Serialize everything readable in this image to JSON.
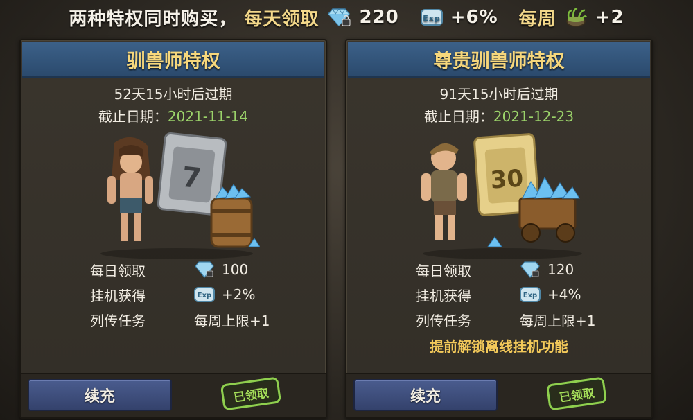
{
  "banner": {
    "intro": "两种特权同时购买，",
    "daily_label": "每天领取",
    "daily_gem_value": "220",
    "exp_value": "+6%",
    "weekly_label": "每周",
    "weekly_value": "+2"
  },
  "panels": [
    {
      "title": "驯兽师特权",
      "expire_text": "52天15小时后过期",
      "deadline_label": "截止日期：",
      "deadline_date": "2021-11-14",
      "card_number": "7",
      "benefits": [
        {
          "label": "每日领取",
          "icon": "gem-icon",
          "value": "100"
        },
        {
          "label": "挂机获得",
          "icon": "exp-icon",
          "value": "+2%"
        },
        {
          "label": "列传任务",
          "icon": "",
          "value": "每周上限+1"
        }
      ],
      "unlock_note": "",
      "renew_label": "续充",
      "claimed_label": "已领取"
    },
    {
      "title": "尊贵驯兽师特权",
      "expire_text": "91天15小时后过期",
      "deadline_label": "截止日期：",
      "deadline_date": "2021-12-23",
      "card_number": "30",
      "benefits": [
        {
          "label": "每日领取",
          "icon": "gem-icon",
          "value": "120"
        },
        {
          "label": "挂机获得",
          "icon": "exp-icon",
          "value": "+4%"
        },
        {
          "label": "列传任务",
          "icon": "",
          "value": "每周上限+1"
        }
      ],
      "unlock_note": "提前解锁离线挂机功能",
      "renew_label": "续充",
      "claimed_label": "已领取"
    }
  ],
  "exp_icon_text": "Exp",
  "colors": {
    "header_blue": "#335479",
    "title_gold": "#f6d77c",
    "date_green": "#9bd36a",
    "unlock_orange": "#f3c95a",
    "button_blue": "#3f4f7d",
    "stamp_green": "#8fcf4e"
  }
}
